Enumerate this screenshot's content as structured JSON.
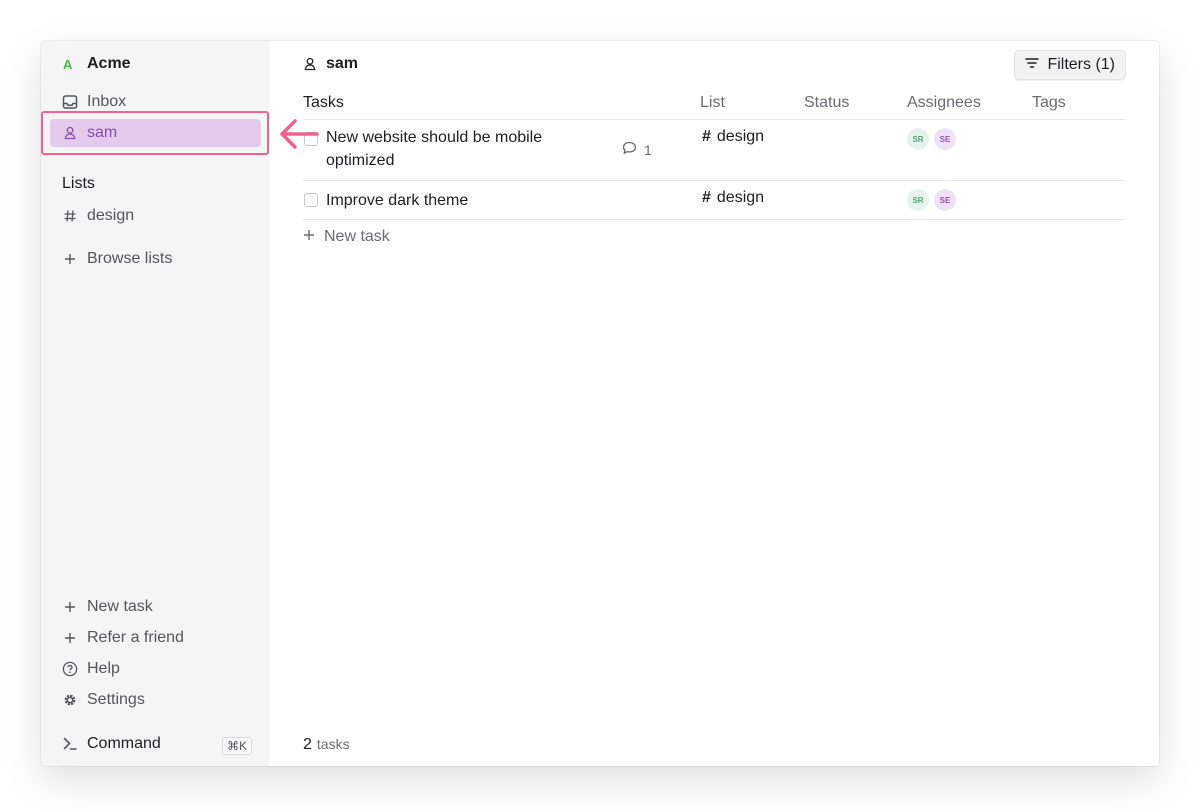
{
  "workspace": {
    "logo_letter": "A",
    "name": "Acme"
  },
  "sidebar": {
    "top_items": [
      {
        "label": "Inbox",
        "icon": "inbox-icon"
      },
      {
        "label": "sam",
        "icon": "user-icon",
        "active": true
      }
    ],
    "lists_title": "Lists",
    "lists": [
      {
        "label": "design",
        "icon": "hash-icon"
      }
    ],
    "browse_lists": "Browse lists",
    "bottom_items": [
      {
        "label": "New task",
        "icon": "plus-icon"
      },
      {
        "label": "Refer a friend",
        "icon": "plus-icon"
      },
      {
        "label": "Help",
        "icon": "help-circle-icon"
      },
      {
        "label": "Settings",
        "icon": "gear-icon"
      }
    ],
    "command": {
      "label": "Command",
      "shortcut": "⌘K"
    }
  },
  "main": {
    "title": "sam",
    "filters_label": "Filters (1)",
    "columns": [
      "Tasks",
      "List",
      "Status",
      "Assignees",
      "Tags"
    ],
    "tasks": [
      {
        "title_line1": "New website should be mobile",
        "title_line2": "optimized",
        "comments": "1",
        "list": "design",
        "assignees": [
          "SR",
          "SE"
        ]
      },
      {
        "title_line1": "Improve dark theme",
        "list": "design",
        "assignees": [
          "SR",
          "SE"
        ]
      }
    ],
    "new_task_label": "New task",
    "footer": {
      "count": "2",
      "unit": "tasks"
    }
  },
  "colors": {
    "accent": "#8a4ea8",
    "active_bg": "#e4caec",
    "highlight": "#f1628f",
    "logo": "#4cb944"
  }
}
